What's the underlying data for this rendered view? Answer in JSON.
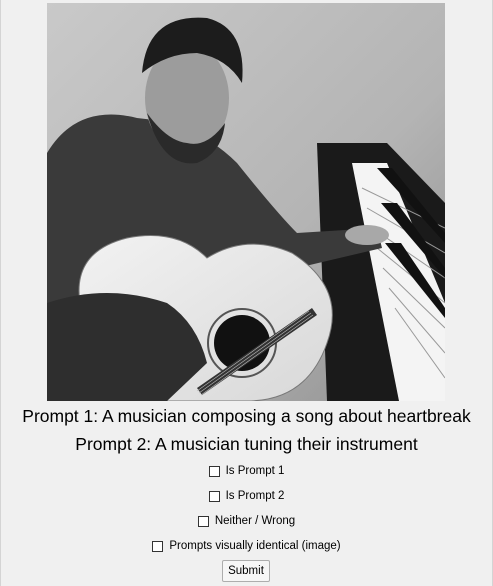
{
  "image": {
    "alt": "A bearded man playing an acoustic guitar beside a piano, black and white photo"
  },
  "prompts": {
    "prompt1": "Prompt 1: A musician composing a song about heartbreak",
    "prompt2": "Prompt 2: A musician tuning their instrument"
  },
  "options": [
    {
      "label": "Is Prompt 1",
      "checked": false
    },
    {
      "label": "Is Prompt 2",
      "checked": false
    },
    {
      "label": "Neither / Wrong",
      "checked": false
    },
    {
      "label": "Prompts visually identical (image)",
      "checked": false
    }
  ],
  "submit_label": "Submit"
}
